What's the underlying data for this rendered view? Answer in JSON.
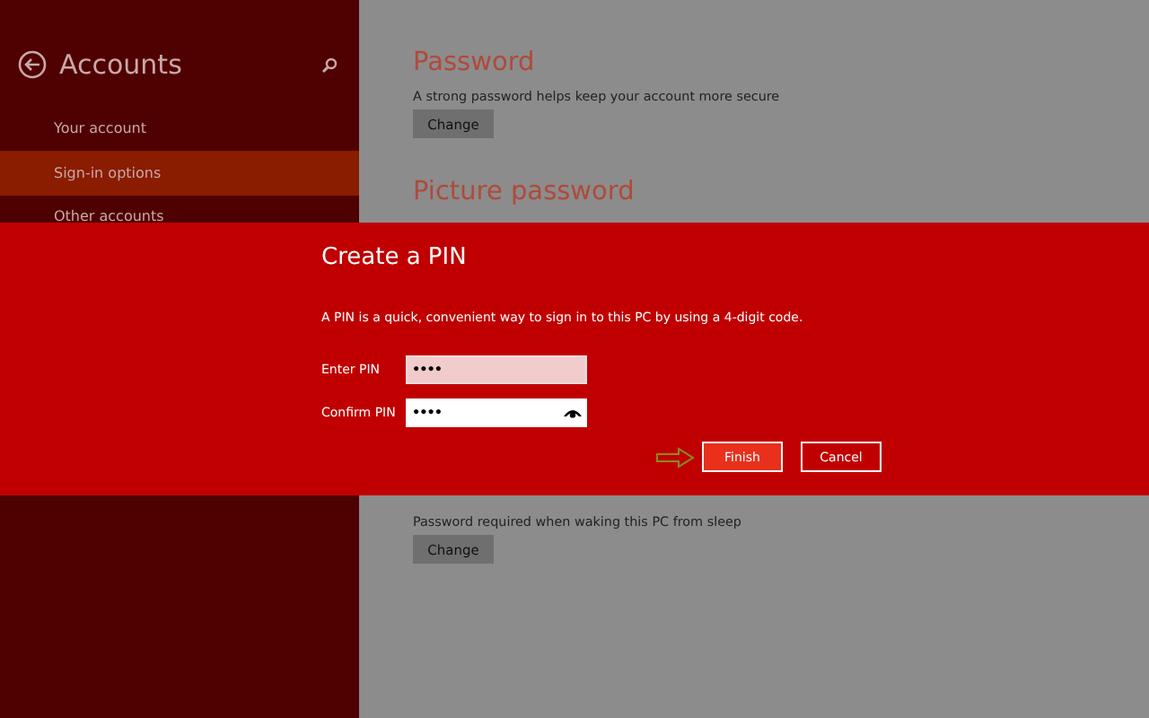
{
  "sidebar": {
    "title": "Accounts",
    "items": [
      {
        "label": "Your account",
        "selected": false
      },
      {
        "label": "Sign-in options",
        "selected": true
      },
      {
        "label": "Other accounts",
        "selected": false
      }
    ]
  },
  "sections": [
    {
      "heading": "Password",
      "text": "A strong password helps keep your account more secure",
      "button": "Change"
    },
    {
      "heading": "Picture password"
    }
  ],
  "lower_section": {
    "text": "Password required when waking this PC from sleep",
    "button": "Change"
  },
  "dialog": {
    "title": "Create a PIN",
    "description": "A PIN is a quick, convenient way to sign in to this PC by using a 4-digit code.",
    "fields": [
      {
        "label": "Enter PIN",
        "value": "●●●●",
        "focused": true,
        "reveal_button": false
      },
      {
        "label": "Confirm PIN",
        "value": "●●●●",
        "focused": false,
        "reveal_button": true
      }
    ],
    "buttons": [
      {
        "label": "Finish",
        "kind": "primary"
      },
      {
        "label": "Cancel",
        "kind": "secondary"
      }
    ]
  }
}
